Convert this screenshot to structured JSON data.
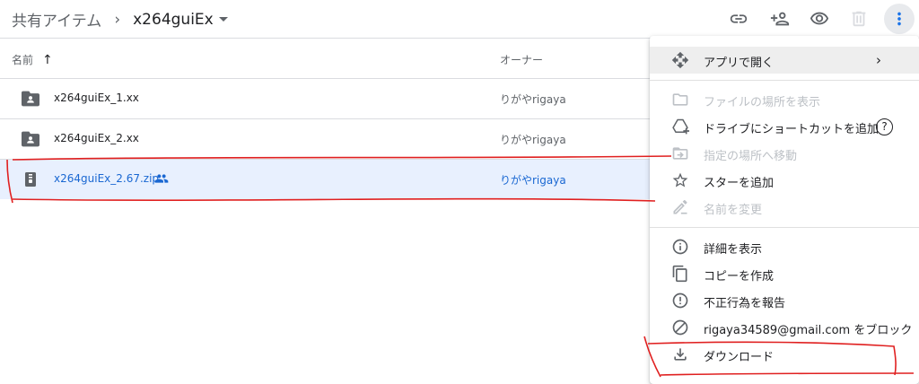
{
  "breadcrumb": {
    "parent": "共有アイテム",
    "separator": "›",
    "current": "x264guiEx"
  },
  "toolbar": [
    {
      "name": "link-icon"
    },
    {
      "name": "add-person-icon"
    },
    {
      "name": "eye-icon"
    },
    {
      "name": "trash-icon"
    },
    {
      "name": "more-vert-icon"
    }
  ],
  "columns": {
    "name": "名前",
    "sort_indicator": "↑",
    "owner": "オーナー"
  },
  "files": [
    {
      "name": "x264guiEx_1.xx",
      "owner": "りがやrigaya",
      "icon": "shared-folder-icon"
    },
    {
      "name": "x264guiEx_2.xx",
      "owner": "りがやrigaya",
      "icon": "shared-folder-icon"
    },
    {
      "name": "x264guiEx_2.67.zip",
      "owner": "りがやrigaya",
      "icon": "zip-file-icon",
      "shared": true,
      "selected": true
    }
  ],
  "menu": {
    "items": [
      {
        "label": "アプリで開く",
        "icon": "move-icon",
        "submenu": "›",
        "highlight": true
      },
      {
        "label": "ファイルの場所を表示",
        "icon": "folder-outline-icon",
        "disabled": true
      },
      {
        "label": "ドライブにショートカットを追加",
        "icon": "drive-add-shortcut-icon",
        "help": "?"
      },
      {
        "label": "指定の場所へ移動",
        "icon": "move-to-folder-icon",
        "disabled": true
      },
      {
        "label": "スターを追加",
        "icon": "star-outline-icon"
      },
      {
        "label": "名前を変更",
        "icon": "pencil-icon",
        "disabled": true
      },
      {
        "label": "詳細を表示",
        "icon": "info-icon"
      },
      {
        "label": "コピーを作成",
        "icon": "copy-icon"
      },
      {
        "label": "不正行為を報告",
        "icon": "report-icon"
      },
      {
        "label": "rigaya34589@gmail.com をブロック",
        "icon": "block-icon"
      },
      {
        "label": "ダウンロード",
        "icon": "download-icon"
      }
    ]
  },
  "colors": {
    "selected_bg": "#e8f0fe",
    "selected_text": "#1967d2",
    "annotation": "#e02020"
  }
}
